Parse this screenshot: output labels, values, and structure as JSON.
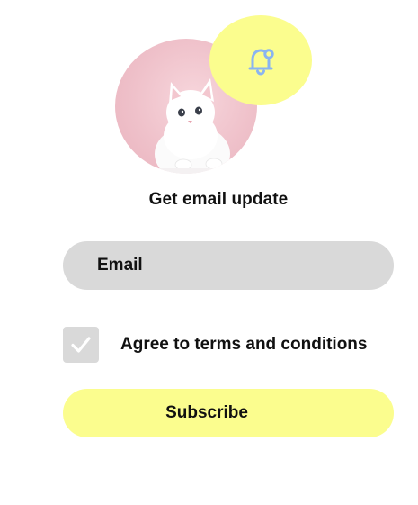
{
  "header": {
    "avatar_icon": "cat-photo",
    "notification_icon": "bell-icon",
    "title": "Get email update"
  },
  "form": {
    "email_label": "Email",
    "terms_checkbox_checked": true,
    "terms_label": "Agree to terms and conditions",
    "subscribe_label": "Subscribe"
  },
  "colors": {
    "accent_yellow": "#fbfd8e",
    "field_gray": "#d9d9d9",
    "bell_blue": "#8ab4f0",
    "avatar_pink": "#efc1ca"
  }
}
